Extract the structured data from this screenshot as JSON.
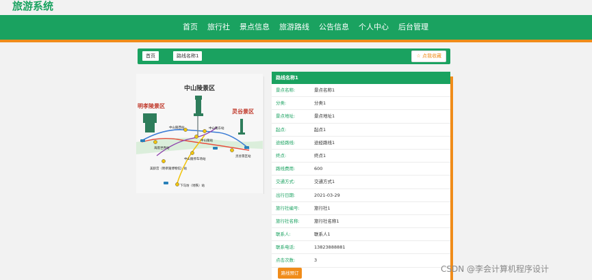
{
  "header": {
    "site_title": "旅游系统",
    "nav": [
      "首页",
      "旅行社",
      "景点信息",
      "旅游路线",
      "公告信息",
      "个人中心",
      "后台管理"
    ]
  },
  "breadcrumb": {
    "home": "首页",
    "current": "路线名称1",
    "favorite_label": "☆ 点我收藏"
  },
  "map": {
    "areas": [
      "中山陵景区",
      "灵谷景区",
      "明孝陵景区"
    ],
    "stations": [
      "中山陵西站",
      "中山陵东站",
      "中山陵站",
      "海底世界站",
      "灵谷景区站",
      "美龄宫（明孝陵博物馆）站",
      "中山陵停车场站",
      "下马坊（地铁）站"
    ]
  },
  "detail": {
    "title": "路线名称1",
    "rows": [
      {
        "label": "景点名称:",
        "value": "景点名称1"
      },
      {
        "label": "分类:",
        "value": "分类1"
      },
      {
        "label": "景点地址:",
        "value": "景点地址1"
      },
      {
        "label": "起点:",
        "value": "起点1"
      },
      {
        "label": "途经路线:",
        "value": "途经路线1"
      },
      {
        "label": "终点:",
        "value": "终点1"
      },
      {
        "label": "路线费用:",
        "value": "600"
      },
      {
        "label": "交通方式:",
        "value": "交通方式1"
      },
      {
        "label": "出行日期:",
        "value": "2021-03-29"
      },
      {
        "label": "旅行社编号:",
        "value": "旅行社1"
      },
      {
        "label": "旅行社名称:",
        "value": "旅行社名称1"
      },
      {
        "label": "联系人:",
        "value": "联系人1"
      },
      {
        "label": "联系电话:",
        "value": "13823888881"
      },
      {
        "label": "点击次数:",
        "value": "3"
      }
    ],
    "book_label": "路线预订"
  },
  "watermark": "CSDN @李会计算机程序设计",
  "colors": {
    "primary": "#1aa260",
    "accent": "#f08c1a"
  }
}
